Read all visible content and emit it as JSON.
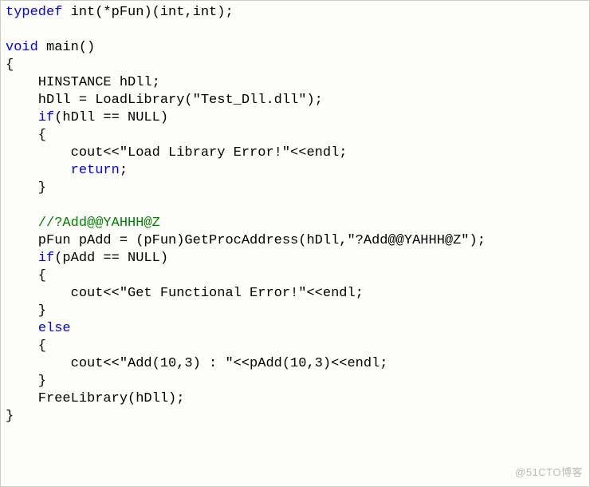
{
  "code": {
    "l1_kw": "typedef",
    "l1_rest": " int(*pFun)(int,int);",
    "l2": "",
    "l3_kw": "void",
    "l3_rest": " main()",
    "l4": "{",
    "l5": "    HINSTANCE hDll;",
    "l6": "    hDll = LoadLibrary(\"Test_Dll.dll\");",
    "l7_a": "    ",
    "l7_kw": "if",
    "l7_b": "(hDll == NULL)",
    "l8": "    {",
    "l9": "        cout<<\"Load Library Error!\"<<endl;",
    "l10_a": "        ",
    "l10_kw": "return",
    "l10_b": ";",
    "l11": "    }",
    "l12": "",
    "l13_a": "    ",
    "l13_cm": "//?Add@@YAHHH@Z",
    "l14": "    pFun pAdd = (pFun)GetProcAddress(hDll,\"?Add@@YAHHH@Z\");",
    "l15_a": "    ",
    "l15_kw": "if",
    "l15_b": "(pAdd == NULL)",
    "l16": "    {",
    "l17": "        cout<<\"Get Functional Error!\"<<endl;",
    "l18": "    }",
    "l19_a": "    ",
    "l19_kw": "else",
    "l20": "    {",
    "l21": "        cout<<\"Add(10,3) : \"<<pAdd(10,3)<<endl;",
    "l22": "    }",
    "l23": "    FreeLibrary(hDll);",
    "l24": "}"
  },
  "watermark": "@51CTO博客"
}
